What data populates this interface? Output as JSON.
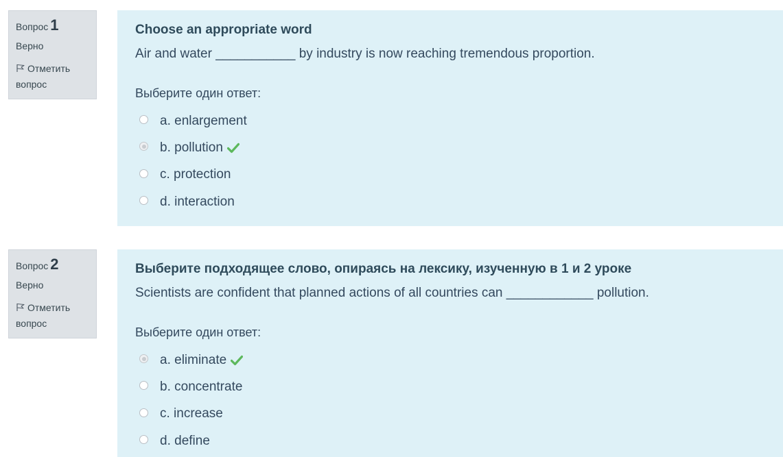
{
  "questions": [
    {
      "label": "Вопрос",
      "number": "1",
      "state": "Верно",
      "flag_label": "Отметить вопрос",
      "title": "Choose an appropriate word",
      "text": "Air and water ___________ by industry is now reaching tremendous proportion.",
      "prompt": "Выберите один ответ:",
      "answers": [
        {
          "label": "a. enlargement",
          "selected": false,
          "correct": false
        },
        {
          "label": "b. pollution",
          "selected": true,
          "correct": true
        },
        {
          "label": "c. protection",
          "selected": false,
          "correct": false
        },
        {
          "label": "d. interaction",
          "selected": false,
          "correct": false
        }
      ]
    },
    {
      "label": "Вопрос",
      "number": "2",
      "state": "Верно",
      "flag_label": "Отметить вопрос",
      "title": "Выберите подходящее слово, опираясь на лексику, изученную в 1 и 2 уроке",
      "text": "Scientists are confident that planned actions of all countries can ____________ pollution.",
      "prompt": "Выберите один ответ:",
      "answers": [
        {
          "label": "a. eliminate",
          "selected": true,
          "correct": true
        },
        {
          "label": "b. concentrate",
          "selected": false,
          "correct": false
        },
        {
          "label": "c. increase",
          "selected": false,
          "correct": false
        },
        {
          "label": "d. define",
          "selected": false,
          "correct": false
        }
      ]
    }
  ],
  "colors": {
    "correct_check": "#5cb85c",
    "content_bg": "#def1f7",
    "info_bg": "#dee2e6"
  }
}
